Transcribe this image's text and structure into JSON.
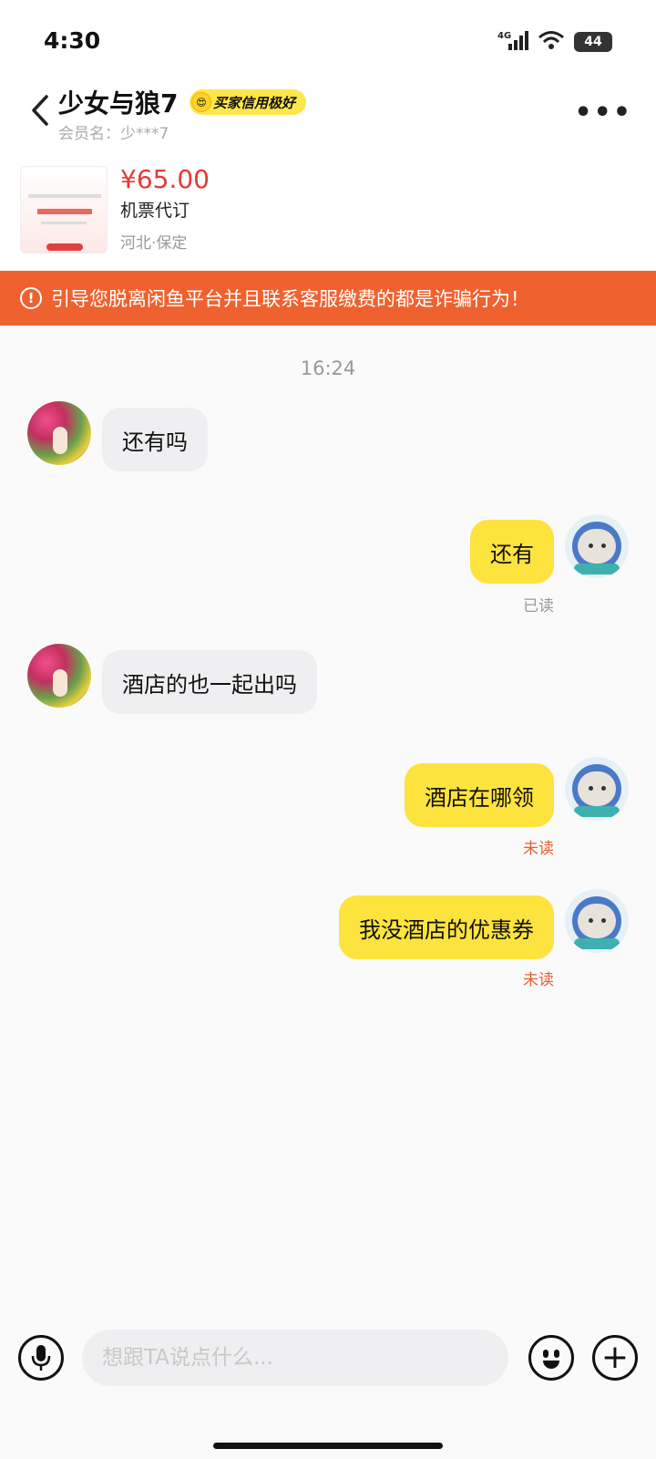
{
  "status_bar": {
    "time": "4:30",
    "network": "4G",
    "battery": "44"
  },
  "header": {
    "title": "少女与狼7",
    "credit_badge": "买家信用极好",
    "member_name": "会员名：少***7"
  },
  "product": {
    "price": "¥65.00",
    "name": "机票代订",
    "location": "河北·保定"
  },
  "warning": {
    "text": "引导您脱离闲鱼平台并且联系客服缴费的都是诈骗行为！"
  },
  "chat": {
    "time": "16:24",
    "messages": [
      {
        "from": "other",
        "text": "还有吗"
      },
      {
        "from": "me",
        "text": "还有",
        "status": "已读"
      },
      {
        "from": "other",
        "text": "酒店的也一起出吗"
      },
      {
        "from": "me",
        "text": "酒店在哪领",
        "status": "未读"
      },
      {
        "from": "me",
        "text": "我没酒店的优惠券",
        "status": "未读"
      }
    ]
  },
  "input": {
    "placeholder": "想跟TA说点什么..."
  },
  "icons": [
    "back-arrow-icon",
    "more-icon",
    "warning-icon",
    "microphone-icon",
    "emoji-icon",
    "plus-icon",
    "signal-icon",
    "wifi-icon",
    "battery-icon"
  ],
  "colors": {
    "warning_bg": "#ef6230",
    "price": "#e53935",
    "outgoing_bubble": "#fde33e",
    "incoming_bubble": "#efeff1",
    "unread": "#e56030"
  }
}
